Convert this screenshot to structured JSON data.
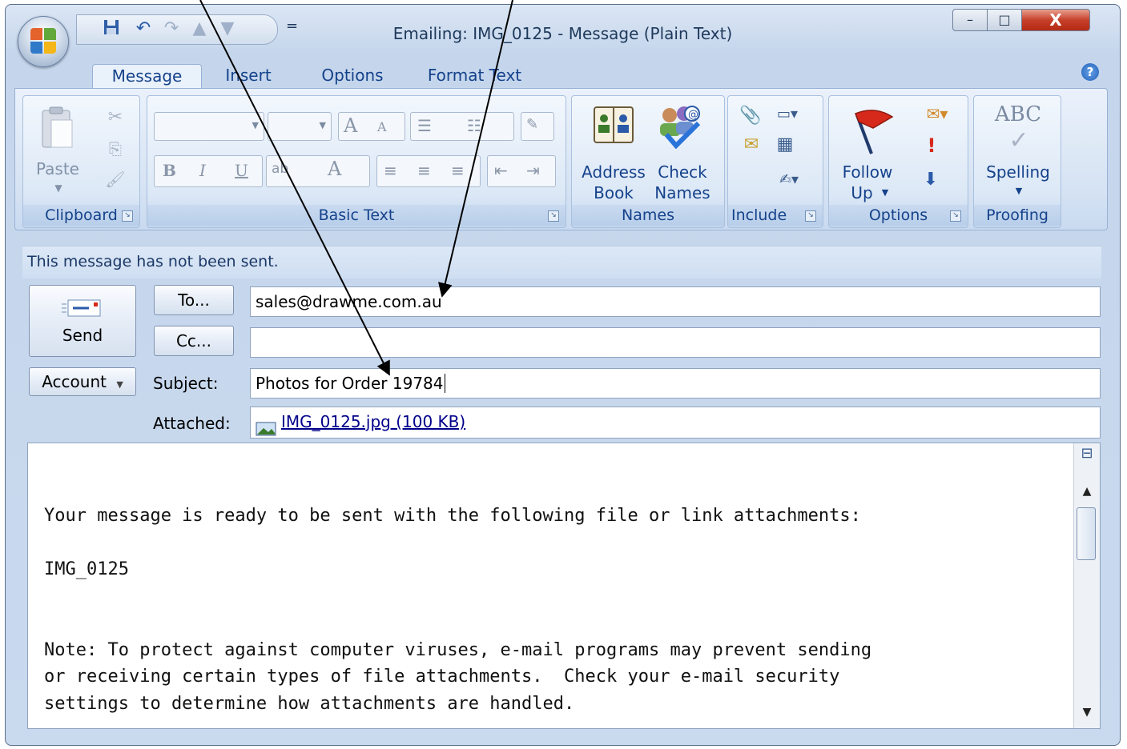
{
  "window": {
    "title": "Emailing: IMG_0125 - Message (Plain Text)",
    "close_glyph": "X",
    "min_glyph": "–",
    "max_glyph": "□"
  },
  "quick_access": {
    "more_glyph": "="
  },
  "tabs": [
    {
      "label": "Message",
      "active": true
    },
    {
      "label": "Insert"
    },
    {
      "label": "Options"
    },
    {
      "label": "Format Text"
    }
  ],
  "help_glyph": "?",
  "ribbon": {
    "clipboard": {
      "label": "Clipboard",
      "paste": "Paste"
    },
    "basic_text": {
      "label": "Basic Text",
      "bold": "B",
      "italic": "I",
      "underline": "U",
      "grow": "A",
      "shrink": "A",
      "font_color": "A",
      "highlight": "ab"
    },
    "names": {
      "label": "Names",
      "address_book": [
        "Address",
        "Book"
      ],
      "check_names": [
        "Check",
        "Names"
      ]
    },
    "include": {
      "label": "Include"
    },
    "options": {
      "label": "Options",
      "follow_up": [
        "Follow",
        "Up"
      ],
      "high_importance": "!",
      "low_importance": "⬇"
    },
    "proofing": {
      "label": "Proofing",
      "spelling": "Spelling",
      "abc": "ABC"
    }
  },
  "infobar": "This message has not been sent.",
  "compose": {
    "send": "Send",
    "to_button": "To...",
    "cc_button": "Cc...",
    "account_button": "Account",
    "subject_label": "Subject:",
    "attached_label": "Attached:",
    "to_value": "sales@drawme.com.au",
    "cc_value": "",
    "subject_value": "Photos for Order 19784",
    "attachment": "IMG_0125.jpg (100 KB)"
  },
  "body": {
    "line1": "Your message is ready to be sent with the following file or link attachments:",
    "line2": "IMG_0125",
    "line3": "Note: To protect against computer viruses, e-mail programs may prevent sending\nor receiving certain types of file attachments.  Check your e-mail security\nsettings to determine how attachments are handled."
  },
  "colors": {
    "accent": "#15428b",
    "frame": "#c5d6ec",
    "close": "#c6402a"
  }
}
